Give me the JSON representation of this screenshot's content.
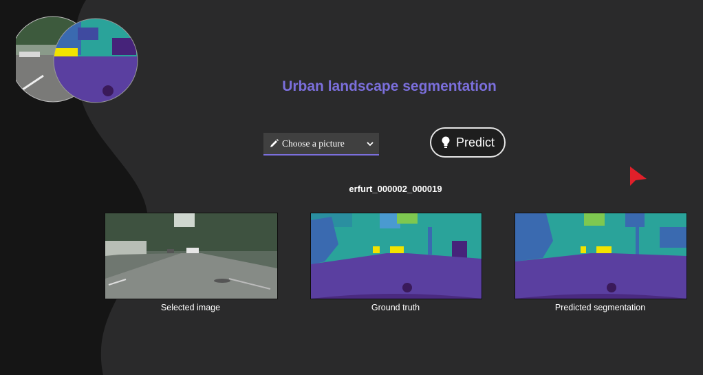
{
  "app": {
    "title": "Urban landscape segmentation",
    "accent": "#7b6fdc"
  },
  "controls": {
    "select_value": "Choose a picture",
    "select_icon": "pencil-icon",
    "predict_label": "Predict",
    "predict_icon": "lightbulb-icon"
  },
  "result": {
    "filename": "erfurt_000002_000019",
    "panels": [
      {
        "caption": "Selected image"
      },
      {
        "caption": "Ground truth"
      },
      {
        "caption": "Predicted segmentation"
      }
    ]
  }
}
